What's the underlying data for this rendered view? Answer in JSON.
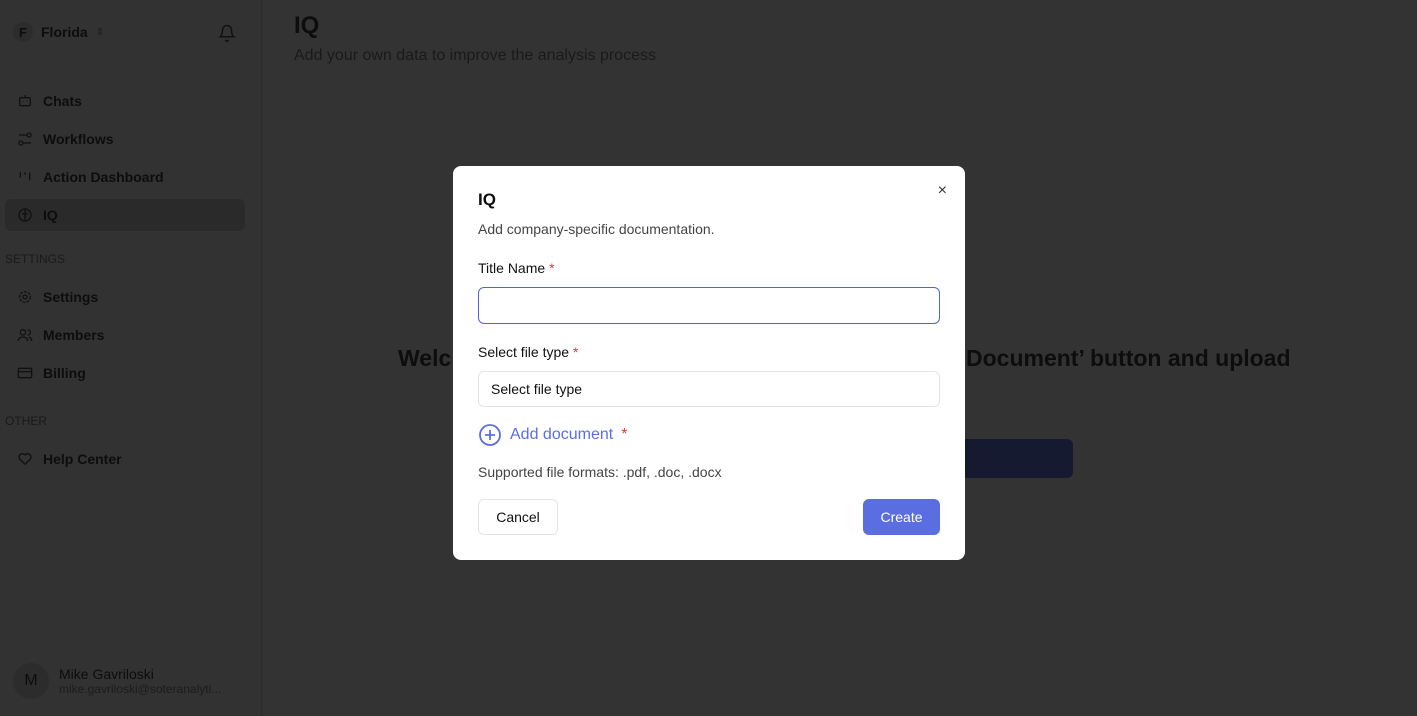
{
  "sidebar": {
    "org": {
      "initial": "F",
      "name": "Florida"
    },
    "items": [
      {
        "label": "Chats",
        "icon": "bot-icon"
      },
      {
        "label": "Workflows",
        "icon": "workflow-icon"
      },
      {
        "label": "Action Dashboard",
        "icon": "kanban-icon"
      },
      {
        "label": "IQ",
        "icon": "brain-icon",
        "active": true
      }
    ],
    "settings_header": "SETTINGS",
    "settings_items": [
      {
        "label": "Settings",
        "icon": "gear-icon"
      },
      {
        "label": "Members",
        "icon": "users-icon"
      },
      {
        "label": "Billing",
        "icon": "credit-card-icon"
      }
    ],
    "other_header": "OTHER",
    "other_items": [
      {
        "label": "Help Center",
        "icon": "heart-handshake-icon"
      }
    ],
    "user": {
      "initial": "M",
      "name": "Mike Gavriloski",
      "email": "mike.gavriloski@soteranalyti..."
    }
  },
  "page": {
    "title": "IQ",
    "subtitle": "Add your own data to improve the analysis process",
    "welcome_left": "Welc",
    "welcome_right": "Document’ button and upload"
  },
  "modal": {
    "title": "IQ",
    "subtitle": "Add company-specific documentation.",
    "title_label": "Title Name",
    "title_value": "",
    "file_type_label": "Select file type",
    "file_type_value": "Select file type",
    "add_document": "Add document",
    "required_mark": "*",
    "formats": "Supported file formats: .pdf, .doc, .docx",
    "cancel": "Cancel",
    "create": "Create",
    "close": "×"
  },
  "colors": {
    "accent": "#5b6ee1",
    "required": "#e5343a",
    "overlay": "#333333"
  }
}
